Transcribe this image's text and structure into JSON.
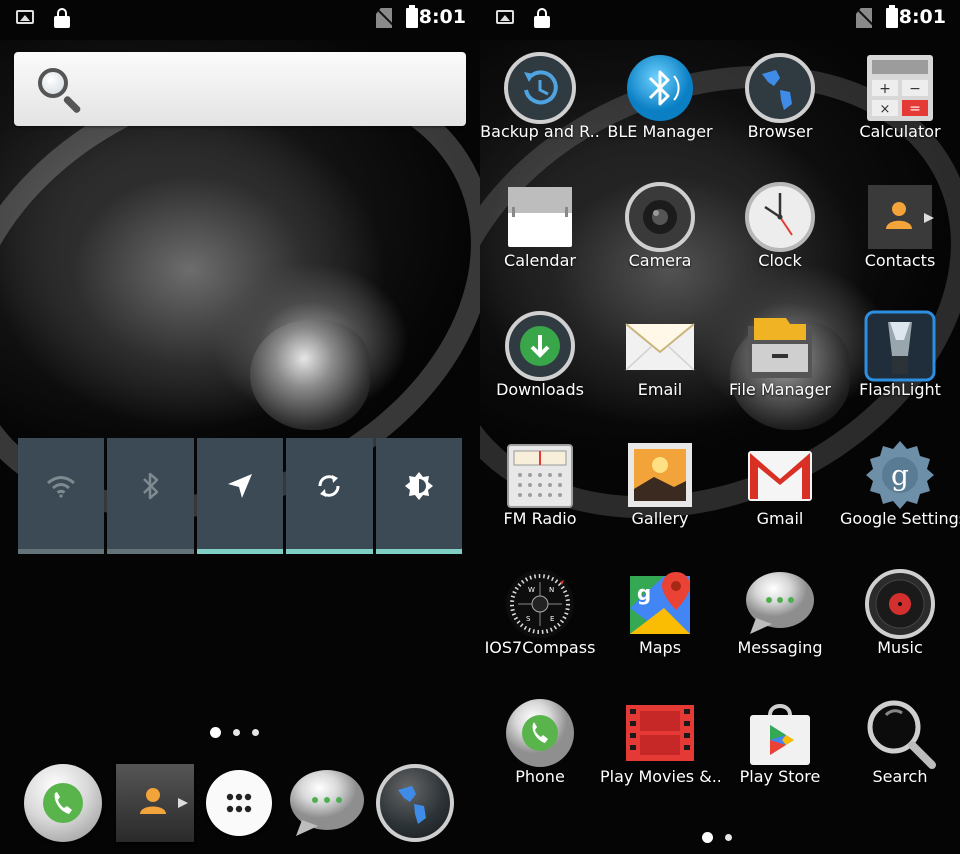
{
  "status_bar": {
    "time": "8:01"
  },
  "home": {
    "quick_settings": [
      "wifi",
      "bluetooth",
      "location",
      "sync",
      "brightness"
    ],
    "page_dots": 3,
    "dock": [
      "Phone",
      "Contacts",
      "All apps",
      "Messaging",
      "Browser"
    ]
  },
  "drawer": {
    "apps": [
      {
        "label": "Backup and R.."
      },
      {
        "label": "BLE Manager"
      },
      {
        "label": "Browser"
      },
      {
        "label": "Calculator"
      },
      {
        "label": "Calendar"
      },
      {
        "label": "Camera"
      },
      {
        "label": "Clock"
      },
      {
        "label": "Contacts"
      },
      {
        "label": "Downloads"
      },
      {
        "label": "Email"
      },
      {
        "label": "File Manager"
      },
      {
        "label": "FlashLight"
      },
      {
        "label": "FM Radio"
      },
      {
        "label": "Gallery"
      },
      {
        "label": "Gmail"
      },
      {
        "label": "Google Settings"
      },
      {
        "label": "IOS7Compass"
      },
      {
        "label": "Maps"
      },
      {
        "label": "Messaging"
      },
      {
        "label": "Music"
      },
      {
        "label": "Phone"
      },
      {
        "label": "Play Movies &.."
      },
      {
        "label": "Play Store"
      },
      {
        "label": "Search"
      }
    ],
    "page_dots": 2
  },
  "colors": {
    "qs_tile": "#3b4a54",
    "qs_on": "#7fcfc4",
    "gmail_red": "#d93025"
  }
}
